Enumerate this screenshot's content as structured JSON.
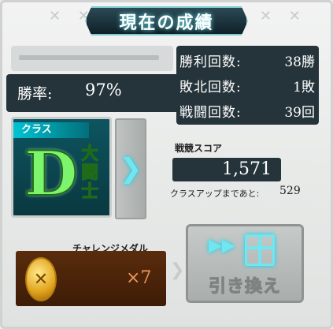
{
  "title": "現在の成績",
  "stats": {
    "win_rate_label": "勝率:",
    "win_rate_value": "97%",
    "wins_label": "勝利回数:",
    "wins_value": "38勝",
    "losses_label": "敗北回数:",
    "losses_value": "1敗",
    "battles_label": "戦闘回数:",
    "battles_value": "39回"
  },
  "class_card": {
    "label": "クラス",
    "letter": "D",
    "name": "大闘士",
    "arrow": "❯"
  },
  "score": {
    "label": "戦競スコア",
    "value": "1,571",
    "classup_label": "クラスアップまであと:",
    "classup_value": "529"
  },
  "medal": {
    "label": "チャレンジメダル",
    "count": "×7"
  },
  "exchange": {
    "label": "引き換え"
  },
  "colors": {
    "accent": "#6fe6f1",
    "panel_dark": "#25343a",
    "class_green": "#7cf56c",
    "medal_count": "#f19a5a"
  },
  "icons": {
    "corner_deco": "cross-icon",
    "arrow": "chevron-right-icon",
    "coin": "medal-coin-icon",
    "fast_forward": "fast-forward-icon",
    "gift": "gift-icon"
  }
}
